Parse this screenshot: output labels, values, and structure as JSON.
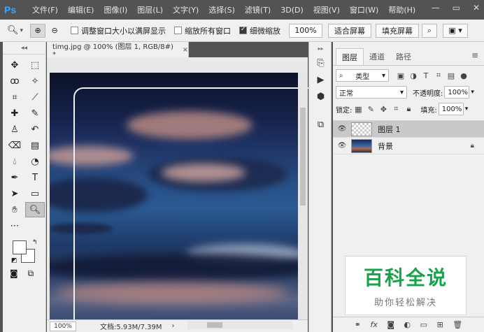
{
  "app": {
    "logo": "Ps"
  },
  "menu": [
    "文件(F)",
    "编辑(E)",
    "图像(I)",
    "图层(L)",
    "文字(Y)",
    "选择(S)",
    "滤镜(T)",
    "3D(D)",
    "视图(V)",
    "窗口(W)",
    "帮助(H)"
  ],
  "options": {
    "resize_windows_label": "调整窗口大小以满屏显示",
    "zoom_all_label": "缩放所有窗口",
    "scrubby_zoom_label": "细微缩放",
    "zoom_value": "100%",
    "fit_screen_label": "适合屏幕",
    "fill_screen_label": "填充屏幕"
  },
  "document": {
    "tab_title": "timg.jpg @ 100% (图层 1, RGB/8#) *",
    "status_zoom": "100%",
    "status_info": "文档:5.93M/7.39M"
  },
  "layers_panel": {
    "tabs": [
      "图层",
      "通道",
      "路径"
    ],
    "kind_filter": "类型",
    "blend_mode": "正常",
    "opacity_label": "不透明度:",
    "opacity_value": "100%",
    "lock_label": "锁定:",
    "fill_label": "填充:",
    "fill_value": "100%",
    "layers": [
      {
        "name": "图层 1",
        "selected": true
      },
      {
        "name": "背景",
        "selected": false
      }
    ]
  },
  "watermark": {
    "title": "百科全说",
    "subtitle": "助你轻松解决"
  },
  "colors": {
    "accent": "#31a8ff",
    "panel_bg": "#f0f0f0",
    "workspace": "#535353",
    "watermark_green": "#16a34a"
  }
}
